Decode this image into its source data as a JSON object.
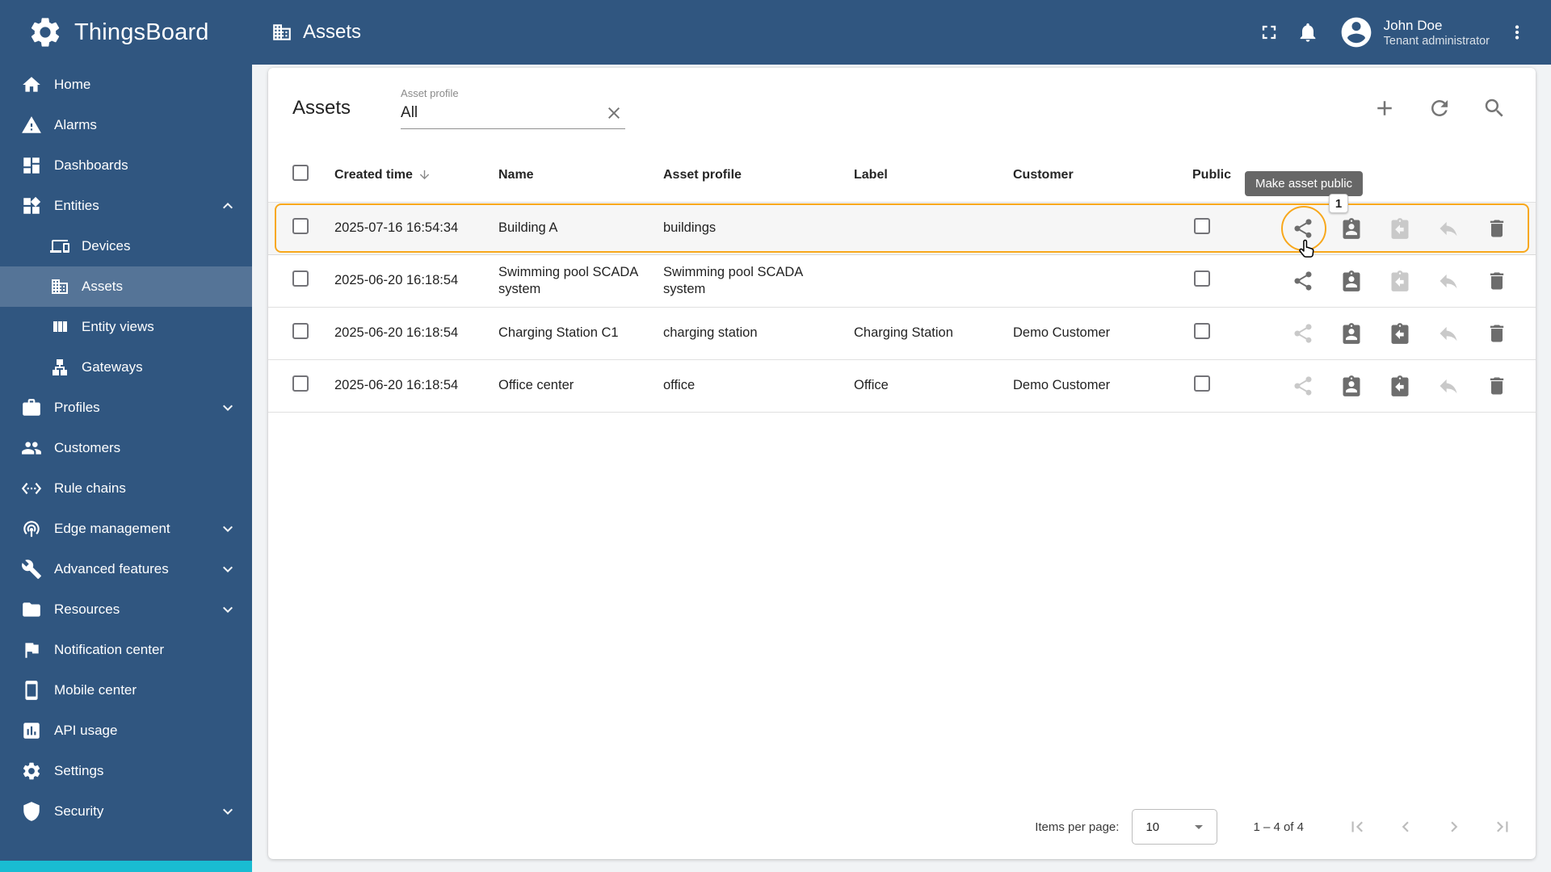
{
  "header": {
    "brand": "ThingsBoard",
    "page_title": "Assets",
    "user": {
      "name": "John Doe",
      "role": "Tenant administrator"
    }
  },
  "sidebar": {
    "items": [
      {
        "label": "Home"
      },
      {
        "label": "Alarms"
      },
      {
        "label": "Dashboards"
      },
      {
        "label": "Entities",
        "expanded": true
      },
      {
        "label": "Devices"
      },
      {
        "label": "Assets",
        "active": true
      },
      {
        "label": "Entity views"
      },
      {
        "label": "Gateways"
      },
      {
        "label": "Profiles"
      },
      {
        "label": "Customers"
      },
      {
        "label": "Rule chains"
      },
      {
        "label": "Edge management"
      },
      {
        "label": "Advanced features"
      },
      {
        "label": "Resources"
      },
      {
        "label": "Notification center"
      },
      {
        "label": "Mobile center"
      },
      {
        "label": "API usage"
      },
      {
        "label": "Settings"
      },
      {
        "label": "Security"
      }
    ]
  },
  "toolbar": {
    "title": "Assets",
    "filter_label": "Asset profile",
    "filter_value": "All"
  },
  "table": {
    "columns": {
      "created": "Created time",
      "name": "Name",
      "profile": "Asset profile",
      "label": "Label",
      "customer": "Customer",
      "public": "Public"
    },
    "rows": [
      {
        "created": "2025-07-16 16:54:34",
        "name": "Building A",
        "profile": "buildings",
        "label": "",
        "customer": ""
      },
      {
        "created": "2025-06-20 16:18:54",
        "name": "Swimming pool SCADA system",
        "profile": "Swimming pool SCADA system",
        "label": "",
        "customer": ""
      },
      {
        "created": "2025-06-20 16:18:54",
        "name": "Charging Station C1",
        "profile": "charging station",
        "label": "Charging Station",
        "customer": "Demo Customer"
      },
      {
        "created": "2025-06-20 16:18:54",
        "name": "Office center",
        "profile": "office",
        "label": "Office",
        "customer": "Demo Customer"
      }
    ]
  },
  "annotation": {
    "tooltip": "Make asset public",
    "step": "1"
  },
  "pagination": {
    "items_per_page_label": "Items per page:",
    "items_per_page_value": "10",
    "range_label": "1 – 4 of 4"
  },
  "colors": {
    "primary": "#305680",
    "highlight": "#f8a81c",
    "teal_strip": "#19bcd2",
    "tooltip_bg": "#616161"
  },
  "icons": {
    "thingsboard-logo-icon": "gear",
    "fullscreen-icon": "expand corners",
    "notifications-icon": "bell",
    "avatar-icon": "account circle",
    "more-menu-icon": "vertical dots",
    "add-icon": "plus",
    "refresh-icon": "circular arrow",
    "search-icon": "magnifier",
    "clear-filter-icon": "x",
    "sort-desc-icon": "down arrow",
    "share-icon": "share nodes",
    "assign-customer-icon": "person clipboard",
    "unassign-customer-icon": "clipboard return arrow",
    "make-private-icon": "reply arrow",
    "delete-icon": "trash can",
    "first-page-icon": "bar left chevron",
    "prev-page-icon": "left chevron",
    "next-page-icon": "right chevron",
    "last-page-icon": "right chevron bar",
    "dropdown-icon": "caret down",
    "cursor-icon": "pointer hand"
  }
}
